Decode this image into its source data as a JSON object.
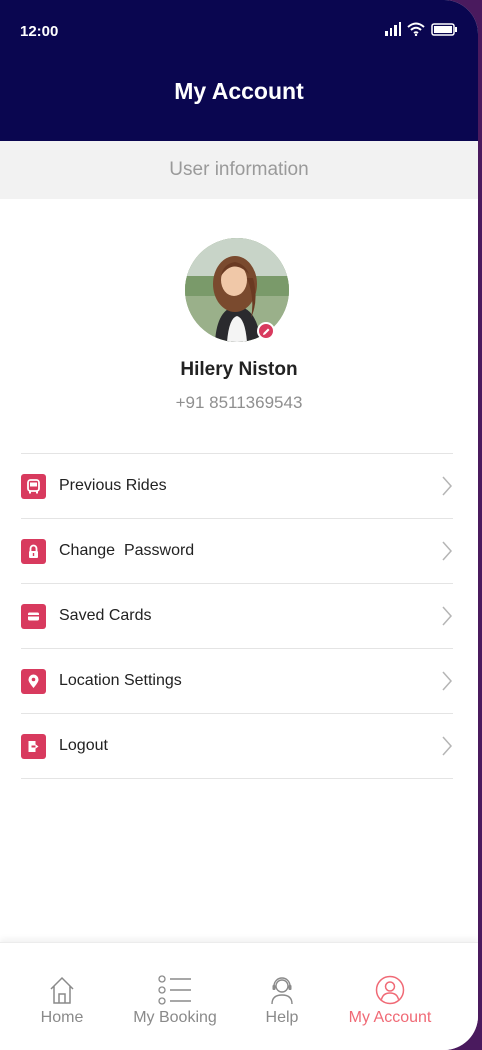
{
  "status_bar": {
    "time": "12:00"
  },
  "header": {
    "title": "My Account"
  },
  "section": {
    "label": "User information"
  },
  "profile": {
    "name": "Hilery Niston",
    "phone": "+91 8511369543"
  },
  "menu": {
    "items": [
      {
        "label": "Previous Rides",
        "icon": "bus-icon"
      },
      {
        "label": "Change  Password",
        "icon": "lock-icon"
      },
      {
        "label": "Saved Cards",
        "icon": "card-icon"
      },
      {
        "label": "Location Settings",
        "icon": "location-pin-icon"
      },
      {
        "label": "Logout",
        "icon": "logout-icon"
      }
    ]
  },
  "bottom_nav": {
    "items": [
      {
        "label": "Home",
        "icon": "home-icon",
        "active": false
      },
      {
        "label": "My Booking",
        "icon": "list-icon",
        "active": false
      },
      {
        "label": "Help",
        "icon": "support-agent-icon",
        "active": false
      },
      {
        "label": "My Account",
        "icon": "user-icon",
        "active": true
      }
    ]
  },
  "colors": {
    "header_bg": "#0a0650",
    "accent": "#d83a5e",
    "active_nav": "#f06a76",
    "section_bg": "#f2f2f2"
  }
}
